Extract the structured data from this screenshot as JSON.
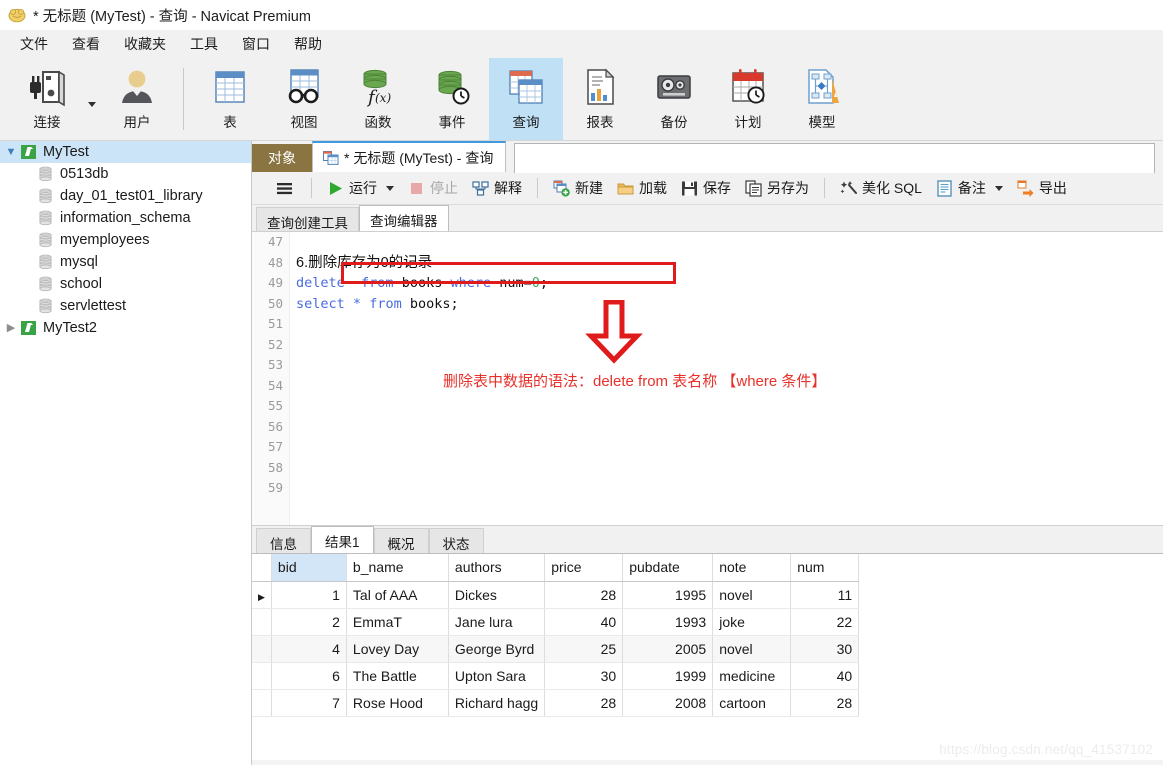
{
  "window": {
    "title": "* 无标题 (MyTest) - 查询 - Navicat Premium",
    "logo_icon": "navicat-logo-icon"
  },
  "menubar": {
    "items": [
      {
        "label": "文件",
        "name": "menu-file"
      },
      {
        "label": "查看",
        "name": "menu-view"
      },
      {
        "label": "收藏夹",
        "name": "menu-favorites"
      },
      {
        "label": "工具",
        "name": "menu-tools"
      },
      {
        "label": "窗口",
        "name": "menu-window"
      },
      {
        "label": "帮助",
        "name": "menu-help"
      }
    ]
  },
  "ribbon": {
    "buttons": [
      {
        "label": "连接",
        "icon": "connection-icon",
        "active": false
      },
      {
        "label": "用户",
        "icon": "user-icon",
        "active": false
      },
      {
        "label": "表",
        "icon": "table-icon",
        "active": false
      },
      {
        "label": "视图",
        "icon": "view-icon",
        "active": false
      },
      {
        "label": "函数",
        "icon": "function-icon",
        "active": false
      },
      {
        "label": "事件",
        "icon": "event-icon",
        "active": false
      },
      {
        "label": "查询",
        "icon": "query-icon",
        "active": true
      },
      {
        "label": "报表",
        "icon": "report-icon",
        "active": false
      },
      {
        "label": "备份",
        "icon": "backup-icon",
        "active": false
      },
      {
        "label": "计划",
        "icon": "schedule-icon",
        "active": false
      },
      {
        "label": "模型",
        "icon": "model-icon",
        "active": false
      }
    ]
  },
  "sidebar": {
    "connections": [
      {
        "label": "MyTest",
        "expanded": true,
        "selected": true,
        "databases": [
          "0513db",
          "day_01_test01_library",
          "information_schema",
          "myemployees",
          "mysql",
          "school",
          "servlettest"
        ]
      },
      {
        "label": "MyTest2",
        "expanded": false,
        "selected": false,
        "databases": []
      }
    ]
  },
  "tabstrip": {
    "object_tab": "对象",
    "query_tab": "* 无标题 (MyTest) - 查询",
    "query_tab_icon": "query-tab-icon"
  },
  "query_toolbar": {
    "menu_icon": "hamburger-menu-icon",
    "items": [
      {
        "label": "运行",
        "icon": "run-icon",
        "disabled": false,
        "caret": true
      },
      {
        "label": "停止",
        "icon": "stop-icon",
        "disabled": true,
        "caret": false
      },
      {
        "label": "解释",
        "icon": "explain-icon",
        "disabled": false,
        "caret": false
      },
      {
        "label": "新建",
        "icon": "new-icon",
        "disabled": false,
        "caret": false
      },
      {
        "label": "加载",
        "icon": "load-icon",
        "disabled": false,
        "caret": false
      },
      {
        "label": "保存",
        "icon": "save-icon",
        "disabled": false,
        "caret": false
      },
      {
        "label": "另存为",
        "icon": "save-as-icon",
        "disabled": false,
        "caret": false
      },
      {
        "label": "美化 SQL",
        "icon": "beautify-sql-icon",
        "disabled": false,
        "caret": false
      },
      {
        "label": "备注",
        "icon": "note-icon",
        "disabled": false,
        "caret": true
      },
      {
        "label": "导出",
        "icon": "export-icon",
        "disabled": false,
        "caret": false
      }
    ]
  },
  "editor_tabs": {
    "items": [
      {
        "label": "查询创建工具",
        "active": false
      },
      {
        "label": "查询编辑器",
        "active": true
      }
    ]
  },
  "editor": {
    "first_line_number": 47,
    "lines": [
      {
        "n": 47,
        "type": "blank",
        "text": ""
      },
      {
        "n": 48,
        "type": "comment_cn",
        "text": "6.删除库存为0的记录"
      },
      {
        "n": 49,
        "type": "sql_delete",
        "text": "delete  from books where num=0;"
      },
      {
        "n": 50,
        "type": "sql_select",
        "text": "select * from books;"
      },
      {
        "n": 51,
        "type": "blank",
        "text": ""
      },
      {
        "n": 52,
        "type": "blank",
        "text": ""
      },
      {
        "n": 53,
        "type": "blank",
        "text": ""
      },
      {
        "n": 54,
        "type": "blank",
        "text": ""
      },
      {
        "n": 55,
        "type": "blank",
        "text": ""
      },
      {
        "n": 56,
        "type": "blank",
        "text": ""
      },
      {
        "n": 57,
        "type": "blank",
        "text": ""
      },
      {
        "n": 58,
        "type": "blank",
        "text": ""
      },
      {
        "n": 59,
        "type": "blank",
        "text": ""
      }
    ],
    "line49_tokens": {
      "kw_delete": "delete",
      "gap1": "  ",
      "kw_from": "from",
      "sp1": " ",
      "tbl": "books",
      "sp2": " ",
      "kw_where": "where",
      "sp3": " ",
      "col": "num=",
      "zero": "0",
      "semi": ";"
    },
    "line50_tokens": {
      "kw_select": "select",
      "sp1": " ",
      "star": "*",
      "sp2": " ",
      "kw_from": "from",
      "sp3": " ",
      "tbl": "books;"
    },
    "annotation": {
      "highlight_color": "#e01b1b",
      "arrow_icon": "red-down-arrow-icon",
      "text": "删除表中数据的语法：delete from 表名称 【where 条件】",
      "text_color": "#e8312a"
    }
  },
  "results": {
    "tabs": [
      {
        "label": "信息",
        "active": false
      },
      {
        "label": "结果1",
        "active": true
      },
      {
        "label": "概况",
        "active": false
      },
      {
        "label": "状态",
        "active": false
      }
    ],
    "grid": {
      "columns": [
        "bid",
        "b_name",
        "authors",
        "price",
        "pubdate",
        "note",
        "num"
      ],
      "highlight_column": "bid",
      "numeric_columns": [
        "bid",
        "price",
        "pubdate",
        "num"
      ],
      "current_row": 0,
      "rows": [
        {
          "bid": "1",
          "b_name": "Tal of AAA",
          "authors": "Dickes",
          "price": "28",
          "pubdate": "1995",
          "note": "novel",
          "num": "11"
        },
        {
          "bid": "2",
          "b_name": "EmmaT",
          "authors": "Jane lura",
          "price": "40",
          "pubdate": "1993",
          "note": "joke",
          "num": "22"
        },
        {
          "bid": "4",
          "b_name": "Lovey Day",
          "authors": "George Byrd",
          "price": "25",
          "pubdate": "2005",
          "note": "novel",
          "num": "30"
        },
        {
          "bid": "6",
          "b_name": "The Battle",
          "authors": "Upton Sara",
          "price": "30",
          "pubdate": "1999",
          "note": "medicine",
          "num": "40"
        },
        {
          "bid": "7",
          "b_name": "Rose Hood",
          "authors": "Richard hagg",
          "price": "28",
          "pubdate": "2008",
          "note": "cartoon",
          "num": "28"
        }
      ]
    }
  },
  "watermark": {
    "text": "https://blog.csdn.net/qq_41537102"
  }
}
